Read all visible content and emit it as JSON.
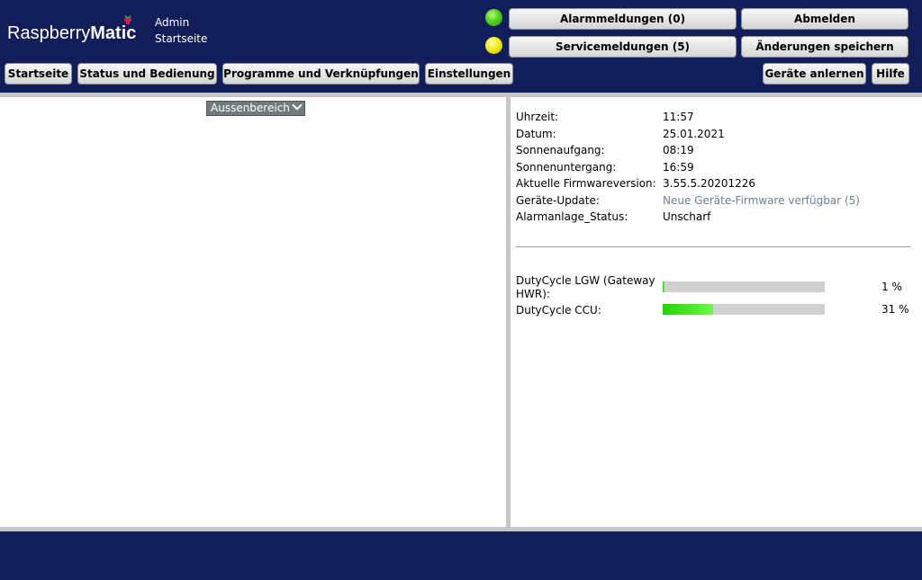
{
  "header": {
    "logo": {
      "light": "Raspberry",
      "bold": "Matic"
    },
    "user": "Admin",
    "location": "Startseite"
  },
  "status": {
    "alarm_led": "green",
    "service_led": "yellow",
    "alarm_label": "Alarmmeldungen (0)",
    "service_label": "Servicemeldungen (5)"
  },
  "actions": {
    "logout": "Abmelden",
    "save_changes": "Änderungen speichern",
    "teach_devices": "Geräte anlernen",
    "help": "Hilfe"
  },
  "nav": [
    {
      "label": "Startseite"
    },
    {
      "label": "Status und Bedienung"
    },
    {
      "label": "Programme und Verknüpfungen"
    },
    {
      "label": "Einstellungen"
    }
  ],
  "room_select": {
    "value": "Aussenbereich"
  },
  "info": [
    {
      "label": "Uhrzeit:",
      "value": "11:57"
    },
    {
      "label": "Datum:",
      "value": "25.01.2021"
    },
    {
      "label": "Sonnenaufgang:",
      "value": "08:19"
    },
    {
      "label": "Sonnenuntergang:",
      "value": "16:59"
    },
    {
      "label": "Aktuelle Firmwareversion:",
      "value": "3.55.5.20201226"
    },
    {
      "label": "Geräte-Update:",
      "value": "Neue Geräte-Firmware verfügbar (5)"
    },
    {
      "label": "Alarmanlage_Status:",
      "value": "Unscharf"
    }
  ],
  "duty_cycle": [
    {
      "label": "DutyCycle LGW (Gateway HWR):",
      "percent": 1,
      "percent_label": "1 %"
    },
    {
      "label": "DutyCycle CCU:",
      "percent": 31,
      "percent_label": "31 %"
    }
  ],
  "colors": {
    "header_bg": "#121e5a",
    "bar_fill": "#22d600",
    "bar_track": "#d0d0d0",
    "link": "#70808a"
  }
}
